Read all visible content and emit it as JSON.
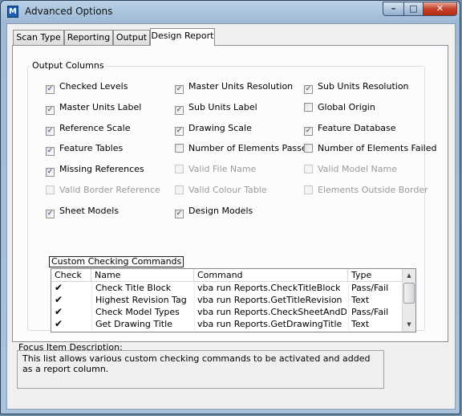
{
  "window": {
    "title": "Advanced Options",
    "app_icon_glyph": "M",
    "minimize_glyph": "–",
    "maximize_glyph": "□",
    "close_glyph": "✕"
  },
  "tabs": [
    {
      "label": "Scan Type",
      "active": false
    },
    {
      "label": "Reporting",
      "active": false
    },
    {
      "label": "Output",
      "active": false
    },
    {
      "label": "Design Report",
      "active": true
    }
  ],
  "output_columns": {
    "label": "Output Columns",
    "items": [
      {
        "label": "Checked Levels",
        "checked": true,
        "enabled": true
      },
      {
        "label": "Master Units Resolution",
        "checked": true,
        "enabled": true
      },
      {
        "label": "Sub Units Resolution",
        "checked": true,
        "enabled": true
      },
      {
        "label": "Master Units Label",
        "checked": true,
        "enabled": true
      },
      {
        "label": "Sub Units Label",
        "checked": true,
        "enabled": true
      },
      {
        "label": "Global Origin",
        "checked": false,
        "enabled": true
      },
      {
        "label": "Reference Scale",
        "checked": true,
        "enabled": true
      },
      {
        "label": "Drawing Scale",
        "checked": true,
        "enabled": true
      },
      {
        "label": "Feature Database",
        "checked": true,
        "enabled": true
      },
      {
        "label": "Feature Tables",
        "checked": true,
        "enabled": true
      },
      {
        "label": "Number of Elements Passed",
        "checked": false,
        "enabled": true
      },
      {
        "label": "Number of Elements Failed",
        "checked": false,
        "enabled": true
      },
      {
        "label": "Missing References",
        "checked": true,
        "enabled": true
      },
      {
        "label": "Valid File Name",
        "checked": false,
        "enabled": false
      },
      {
        "label": "Valid Model Name",
        "checked": false,
        "enabled": false
      },
      {
        "label": "Valid Border Reference",
        "checked": false,
        "enabled": false
      },
      {
        "label": "Valid Colour Table",
        "checked": false,
        "enabled": false
      },
      {
        "label": "Elements Outside Border",
        "checked": false,
        "enabled": false
      },
      {
        "label": "Sheet Models",
        "checked": true,
        "enabled": true
      },
      {
        "label": "Design Models",
        "checked": true,
        "enabled": true
      }
    ]
  },
  "custom_commands": {
    "label": "Custom Checking Commands",
    "columns": [
      "Check",
      "Name",
      "Command",
      "Type"
    ],
    "check_glyph": "✔",
    "rows": [
      {
        "check": "✔",
        "name": "Check Title Block",
        "command": "vba run Reports.CheckTitleBlock",
        "type": "Pass/Fail"
      },
      {
        "check": "✔",
        "name": "Highest Revision Tag",
        "command": "vba run Reports.GetTitleRevision",
        "type": "Text"
      },
      {
        "check": "✔",
        "name": "Check Model Types",
        "command": "vba run Reports.CheckSheetAndDesign",
        "type": "Pass/Fail"
      },
      {
        "check": "✔",
        "name": "Get Drawing Title",
        "command": "vba run Reports.GetDrawingTitle",
        "type": "Text"
      }
    ],
    "scroll_up_glyph": "▲",
    "scroll_down_glyph": "▼"
  },
  "focus": {
    "label": "Focus Item Description:",
    "description": "This list allows various custom checking commands to be activated and added as a report column."
  }
}
